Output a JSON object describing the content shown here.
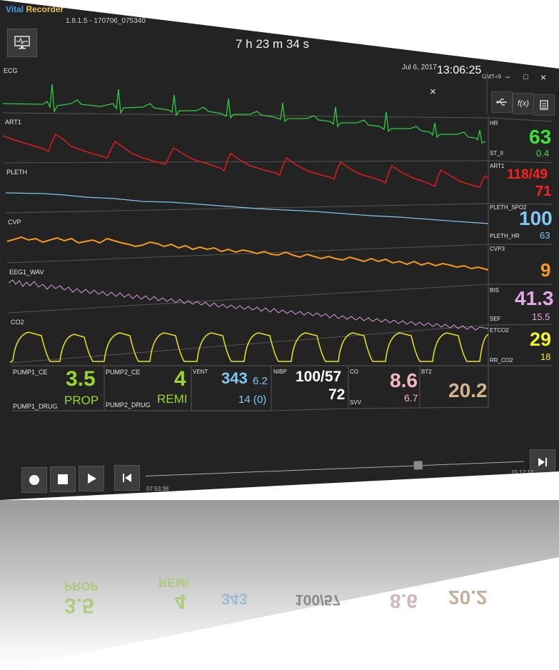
{
  "app": {
    "name_part1": "Vital",
    "name_part2": "Recorder",
    "version": "1.8.1.5 - 170706_075340"
  },
  "header": {
    "elapsed": "7 h 23 m 34 s",
    "date": "Jul 6, 2017",
    "time": "13:06:25",
    "timezone": "GMT+9"
  },
  "window_controls": {
    "minimize": "–",
    "maximize": "□",
    "close": "×"
  },
  "panel_close": "×",
  "side_buttons": [
    {
      "name": "usb-icon",
      "label": "⇽"
    },
    {
      "name": "function-icon",
      "label": "f(x)"
    },
    {
      "name": "document-icon",
      "label": "≡"
    }
  ],
  "waveforms": [
    {
      "label": "ECG",
      "color": "#2ecc40"
    },
    {
      "label": "ART1",
      "color": "#e01b1b"
    },
    {
      "label": "PLETH",
      "color": "#7ec8f2"
    },
    {
      "label": "CVP",
      "color": "#f59a1b"
    },
    {
      "label": "EEG1_WAV",
      "color": "#d8a0dc"
    },
    {
      "label": "CO2",
      "color": "#e8e81a"
    }
  ],
  "params": {
    "hr": {
      "label": "HR",
      "value": "63",
      "sub_label": "ST_II",
      "sub_value": "0.4",
      "color": "#39e339"
    },
    "art1": {
      "label": "ART1",
      "value": "118/49",
      "sub_value": "71",
      "color": "#ff2020"
    },
    "spo2": {
      "label": "PLETH_SPO2",
      "value": "100",
      "sub_label": "PLETH_HR",
      "sub_value": "63",
      "color": "#7ec8f2"
    },
    "cvp": {
      "label": "CVP3",
      "value": "9",
      "color": "#f59a1b"
    },
    "bis": {
      "label": "BIS",
      "value": "41.3",
      "sub_label": "SEF",
      "sub_value": "15.5",
      "color": "#e2a8e6"
    },
    "etco2": {
      "label": "ETCO2",
      "value": "29",
      "sub_label": "RR_CO2",
      "sub_value": "18",
      "color": "#f2f21e"
    }
  },
  "pumps": [
    {
      "label": "PUMP1_CE",
      "value": "3.5",
      "drug_label": "PUMP1_DRUG",
      "drug": "PROP",
      "color": "#9bd431"
    },
    {
      "label": "PUMP2_CE",
      "value": "4",
      "drug_label": "PUMP2_DRUG",
      "drug": "REMI",
      "color": "#9bd431"
    }
  ],
  "bottom_params": {
    "vent": {
      "label": "VENT",
      "value": "343",
      "sub1": "6.2",
      "sub2": "14 (0)",
      "color": "#7ec8f2"
    },
    "nibp": {
      "label": "NIBP",
      "value": "100/57",
      "sub": "72",
      "color": "#ffffff"
    },
    "co": {
      "label": "CO",
      "value": "8.6",
      "sub_label": "SVV",
      "sub_value": "6.7",
      "color": "#f4b6c2"
    },
    "bt2": {
      "label": "BT2",
      "value": "20.2",
      "color": "#d4b48c"
    }
  },
  "playback": {
    "start_time": "07:53:38",
    "end_time": "15:17:13",
    "position": 0.72
  }
}
